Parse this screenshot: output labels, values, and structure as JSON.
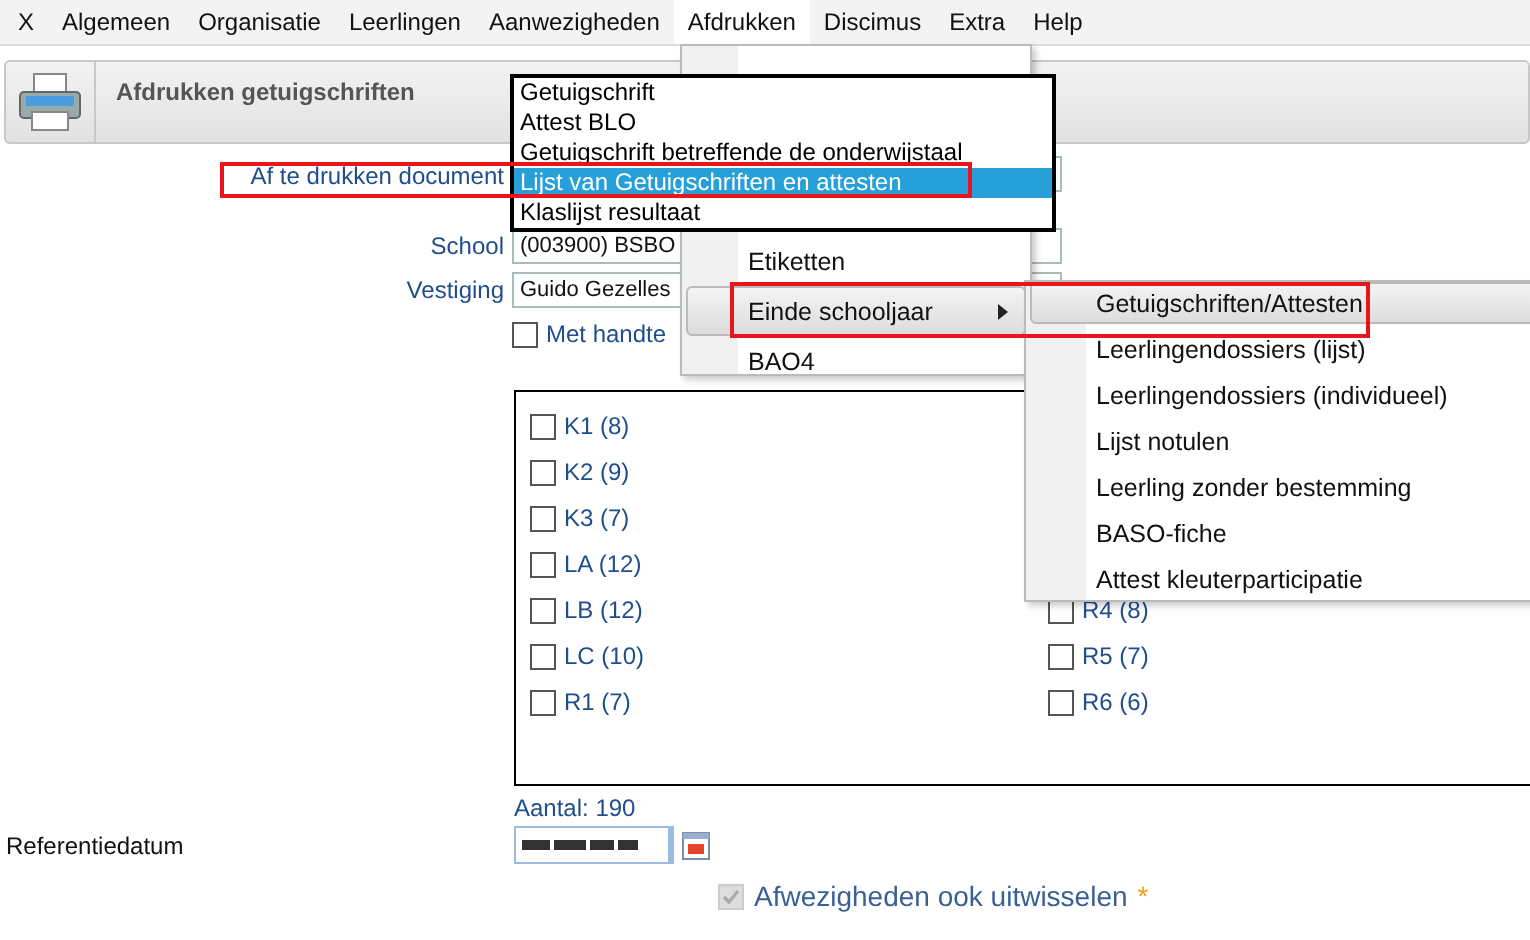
{
  "menubar": {
    "items": [
      {
        "label": "X",
        "selected": false
      },
      {
        "label": "Algemeen",
        "selected": false
      },
      {
        "label": "Organisatie",
        "selected": false
      },
      {
        "label": "Leerlingen",
        "selected": false
      },
      {
        "label": "Aanwezigheden",
        "selected": false
      },
      {
        "label": "Afdrukken",
        "selected": true
      },
      {
        "label": "Discimus",
        "selected": false
      },
      {
        "label": "Extra",
        "selected": false
      },
      {
        "label": "Help",
        "selected": false
      }
    ]
  },
  "header": {
    "title": "Afdrukken getuigschriften"
  },
  "form": {
    "document_label": "Af te drukken document",
    "school_label": "School",
    "school_value": "(003900) BSBO",
    "branch_label": "Vestiging",
    "branch_value": "Guido Gezelles",
    "signature_option": {
      "label": "Met handte",
      "checked": false
    }
  },
  "classes": {
    "column_1": [
      {
        "label": "K1 (8)",
        "checked": false
      },
      {
        "label": "K2 (9)",
        "checked": false
      },
      {
        "label": "K3 (7)",
        "checked": false
      },
      {
        "label": "LA (12)",
        "checked": false
      },
      {
        "label": "LB (12)",
        "checked": false
      },
      {
        "label": "LC (10)",
        "checked": false
      },
      {
        "label": "R1 (7)",
        "checked": false
      }
    ],
    "column_2": [
      {
        "label": "R4 (8)",
        "checked": false
      },
      {
        "label": "R5 (7)",
        "checked": false
      },
      {
        "label": "R6 (6)",
        "checked": false
      }
    ]
  },
  "count": "Aantal: 190",
  "reference_date": {
    "label": "Referentiedatum"
  },
  "exchange_absences": {
    "label": "Afwezigheden ook uitwisselen",
    "checked": true,
    "disabled": true,
    "required_mark": "*"
  },
  "document_dropdown": {
    "options": [
      {
        "label": "Getuigschrift",
        "selected": false
      },
      {
        "label": "Attest BLO",
        "selected": false
      },
      {
        "label": "Getuigschrift betreffende de onderwijstaal",
        "selected": false
      },
      {
        "label": "Lijst van Getuigschriften en attesten",
        "selected": true
      },
      {
        "label": "Klaslijst resultaat",
        "selected": false
      }
    ]
  },
  "print_menu": {
    "items": [
      {
        "label": "Etiketten",
        "selected": false,
        "has_submenu": false
      },
      {
        "label": "Einde schooljaar",
        "selected": true,
        "has_submenu": true
      },
      {
        "label": "BAO4",
        "selected": false,
        "has_submenu": false
      }
    ]
  },
  "submenu": {
    "items": [
      {
        "label": "Getuigschriften/Attesten",
        "selected": true
      },
      {
        "label": "Leerlingendossiers (lijst)",
        "selected": false
      },
      {
        "label": "Leerlingendossiers (individueel)",
        "selected": false
      },
      {
        "label": "Lijst notulen",
        "selected": false
      },
      {
        "label": "Leerling zonder bestemming",
        "selected": false
      },
      {
        "label": "BASO-fiche",
        "selected": false
      },
      {
        "label": "Attest kleuterparticipatie",
        "selected": false
      }
    ]
  }
}
